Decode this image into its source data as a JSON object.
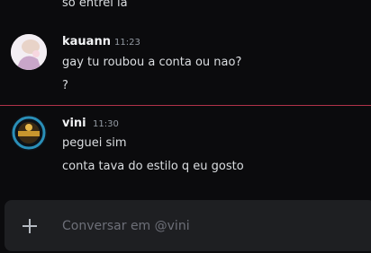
{
  "messages": [
    {
      "text": "só entrei lá"
    }
  ],
  "groups": [
    {
      "author": "kauann",
      "time": "11:23",
      "lines": [
        "gay tu roubou a conta ou nao?",
        "?"
      ]
    },
    {
      "author": "vini",
      "time": "11:30",
      "lines": [
        "peguei sim",
        "conta tava do estilo q eu gosto"
      ]
    }
  ],
  "composer": {
    "placeholder": "Conversar em @vini"
  },
  "colors": {
    "new_messages_divider": "#b1324a",
    "background": "#0b0b0d",
    "composer_bg": "#1e1f22"
  }
}
